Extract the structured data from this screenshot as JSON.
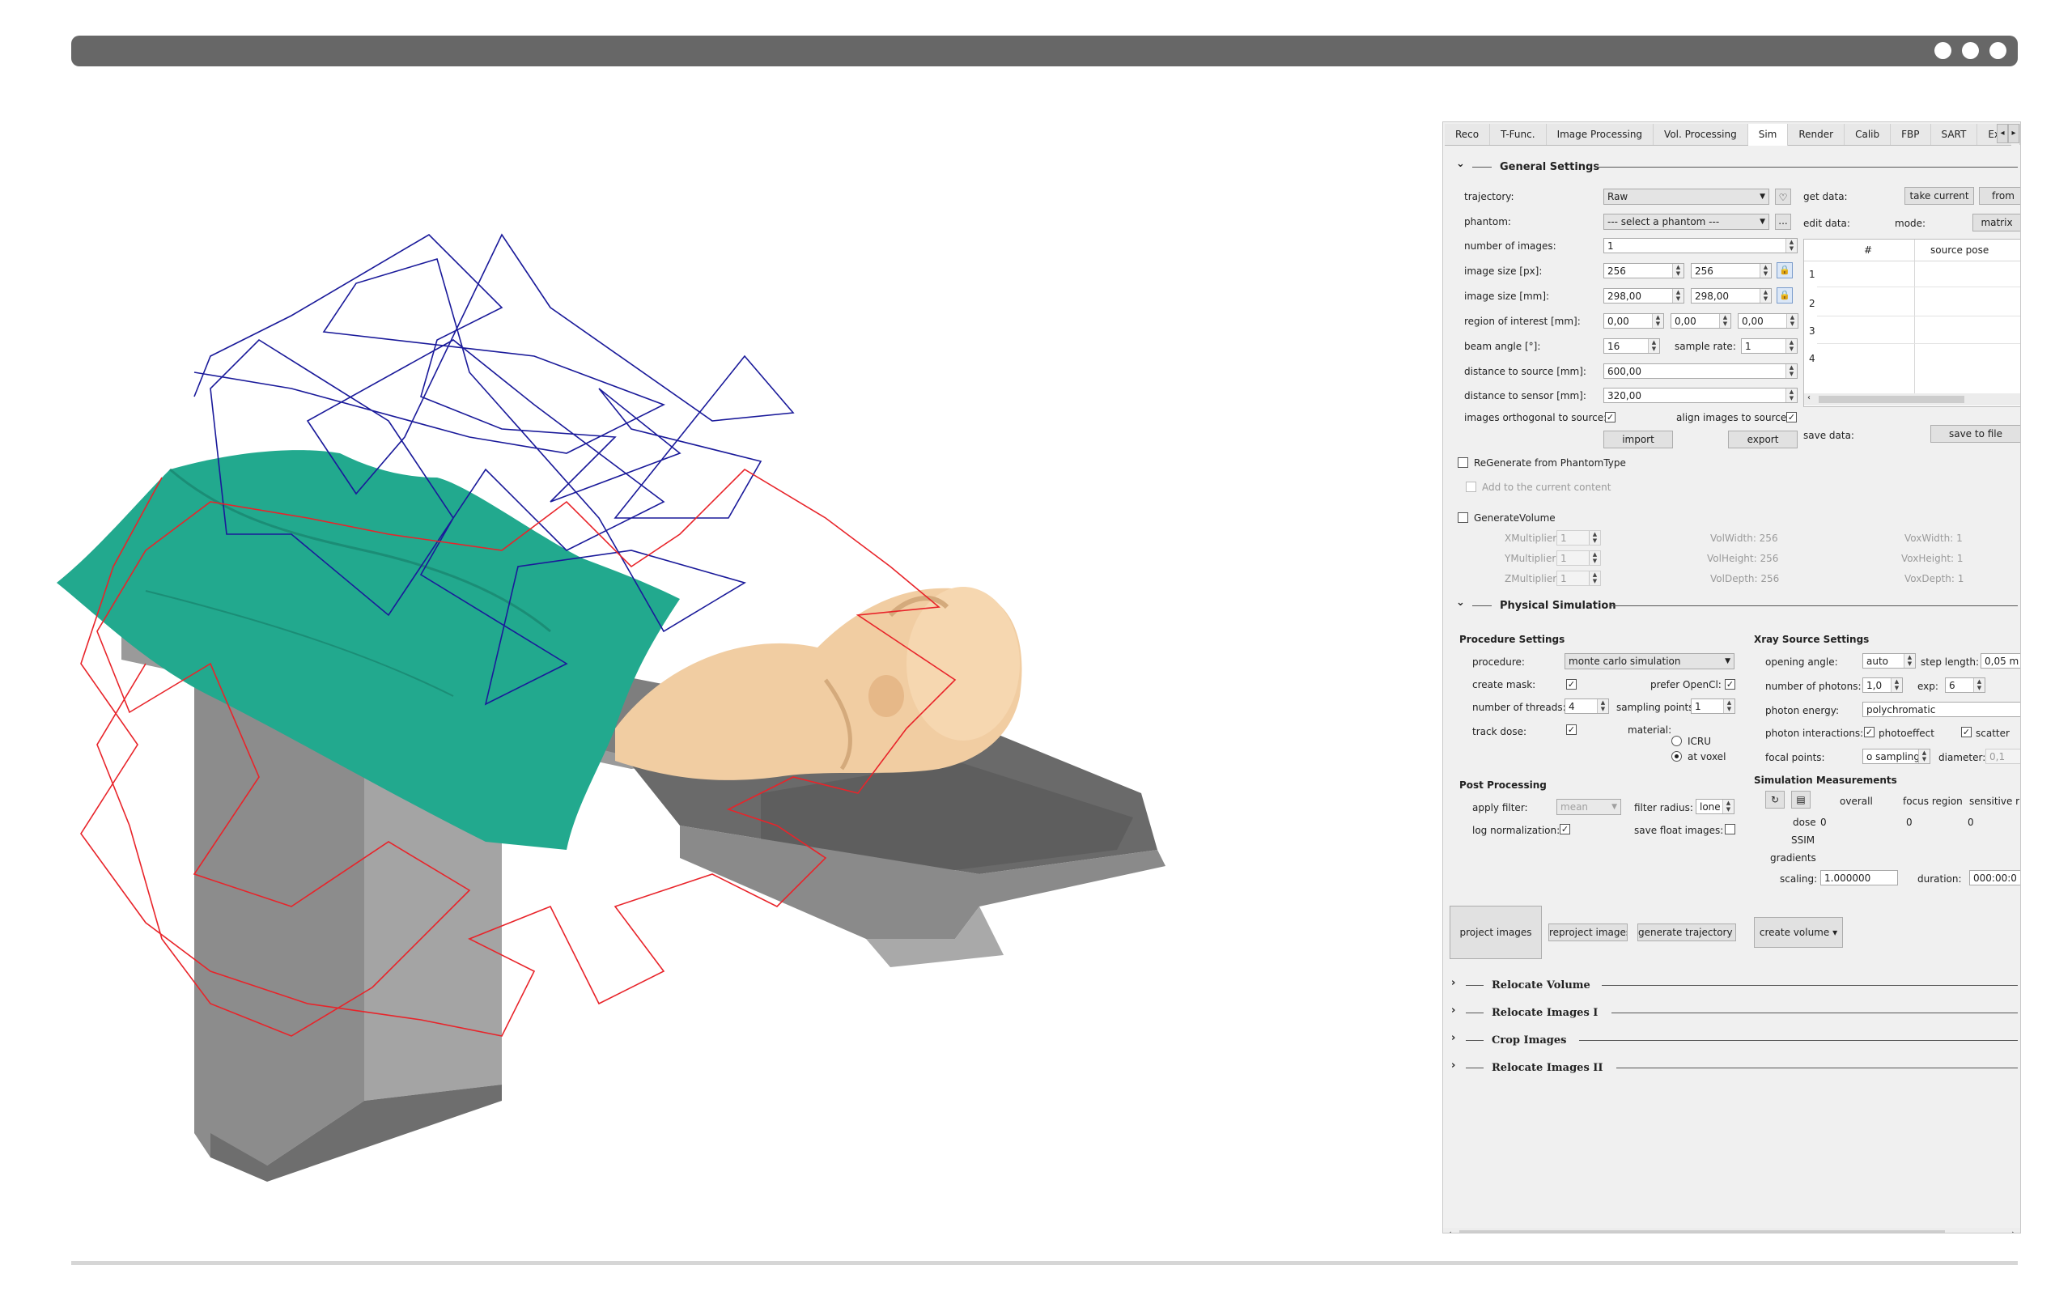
{
  "window": {
    "menu_icon": "three-dots-icon"
  },
  "tabs": [
    "Reco",
    "T-Func.",
    "Image Processing",
    "Vol. Processing",
    "Sim",
    "Render",
    "Calib",
    "FBP",
    "SART",
    "Exp."
  ],
  "active_tab": "Sim",
  "general_settings": {
    "title": "General Settings",
    "trajectory_label": "trajectory:",
    "trajectory_value": "Raw",
    "phantom_label": "phantom:",
    "phantom_value": "--- select a phantom ---",
    "phantom_browse": "...",
    "num_images_label": "number of images:",
    "num_images_value": "1",
    "image_size_px_label": "image size [px]:",
    "image_size_px_w": "256",
    "image_size_px_h": "256",
    "image_size_mm_label": "image size [mm]:",
    "image_size_mm_w": "298,00",
    "image_size_mm_h": "298,00",
    "roi_label": "region of interest [mm]:",
    "roi_x": "0,00",
    "roi_y": "0,00",
    "roi_z": "0,00",
    "beam_angle_label": "beam angle [°]:",
    "beam_angle_value": "16",
    "sample_rate_label": "sample rate:",
    "sample_rate_value": "1",
    "dist_source_label": "distance to source [mm]:",
    "dist_source_value": "600,00",
    "dist_sensor_label": "distance to sensor [mm]:",
    "dist_sensor_value": "320,00",
    "orthogonal_label": "images orthogonal to source:",
    "align_label": "align images to source:",
    "import_label": "import",
    "export_label": "export",
    "get_data_label": "get data:",
    "take_current_label": "take current",
    "from_label": "from",
    "edit_data_label": "edit data:",
    "mode_label": "mode:",
    "matrix_label": "matrix",
    "table_col_num": "#",
    "table_col_pose": "source pose",
    "table_rows": [
      "1",
      "2",
      "3",
      "4"
    ],
    "save_data_label": "save data:",
    "save_to_file_label": "save to file"
  },
  "regenerate": {
    "label": "ReGenerate from PhantomType",
    "add_label": "Add to the current content"
  },
  "generate_volume": {
    "label": "GenerateVolume",
    "xmult_label": "XMultiplier:",
    "xmult_value": "1",
    "ymult_label": "YMultiplier:",
    "ymult_value": "1",
    "zmult_label": "ZMultiplier:",
    "zmult_value": "1",
    "volwidth": "VolWidth: 256",
    "volheight": "VolHeight: 256",
    "voldepth": "VolDepth: 256",
    "voxwidth": "VoxWidth: 1",
    "voxheight": "VoxHeight: 1",
    "voxdepth": "VoxDepth: 1"
  },
  "physical_simulation": {
    "title": "Physical Simulation",
    "procedure_settings": "Procedure Settings",
    "procedure_label": "procedure:",
    "procedure_value": "monte carlo simulation",
    "create_mask_label": "create mask:",
    "prefer_opencl_label": "prefer OpenCl:",
    "threads_label": "number of threads:",
    "threads_value": "4",
    "sampling_points_label": "sampling points",
    "sampling_points_value": "1",
    "track_dose_label": "track dose:",
    "material_label": "material:",
    "icru_label": "ICRU",
    "at_voxel_label": "at voxel",
    "post_processing": "Post Processing",
    "apply_filter_label": "apply filter:",
    "apply_filter_value": "mean",
    "filter_radius_label": "filter radius:",
    "filter_radius_value": "lone",
    "log_norm_label": "log normalization:",
    "save_float_label": "save float images:",
    "xray_settings": "Xray Source Settings",
    "opening_angle_label": "opening angle:",
    "opening_angle_value": "auto",
    "step_length_label": "step length:",
    "step_length_value": "0,05 m",
    "photons_label": "number of photons:",
    "photons_value": "1,0",
    "exp_label": "exp:",
    "exp_value": "6",
    "photon_energy_label": "photon energy:",
    "photon_energy_value": "polychromatic",
    "interactions_label": "photon interactions:",
    "photoeffect_label": "photoeffect",
    "scatter_label": "scatter",
    "focal_points_label": "focal points:",
    "focal_points_value": "o sampling",
    "diameter_label": "diameter:",
    "diameter_value": "0,1",
    "sim_measurements": "Simulation Measurements",
    "overall_label": "overall",
    "focus_region_label": "focus region",
    "sensitive_label": "sensitive r",
    "dose_label": "dose",
    "dose_overall": "0",
    "dose_focus": "0",
    "dose_sensitive": "0",
    "ssim_label": "SSIM",
    "gradients_label": "gradients",
    "scaling_label": "scaling:",
    "scaling_value": "1.000000",
    "duration_label": "duration:",
    "duration_value": "000:00:0"
  },
  "actions": {
    "project_images": "project images",
    "reproject_images": "reproject images",
    "generate_trajectory": "generate trajectory",
    "create_volume": "create volume"
  },
  "collapsed_sections": [
    "Relocate Volume",
    "Relocate Images I",
    "Crop Images",
    "Relocate Images II"
  ],
  "colors": {
    "titlebar": "#676767",
    "sheet": "#22a98e",
    "skin": "#f1cda2",
    "table": "#8e8e8e",
    "trajectory_blue": "#1a1a9a",
    "trajectory_red": "#e8242a"
  }
}
